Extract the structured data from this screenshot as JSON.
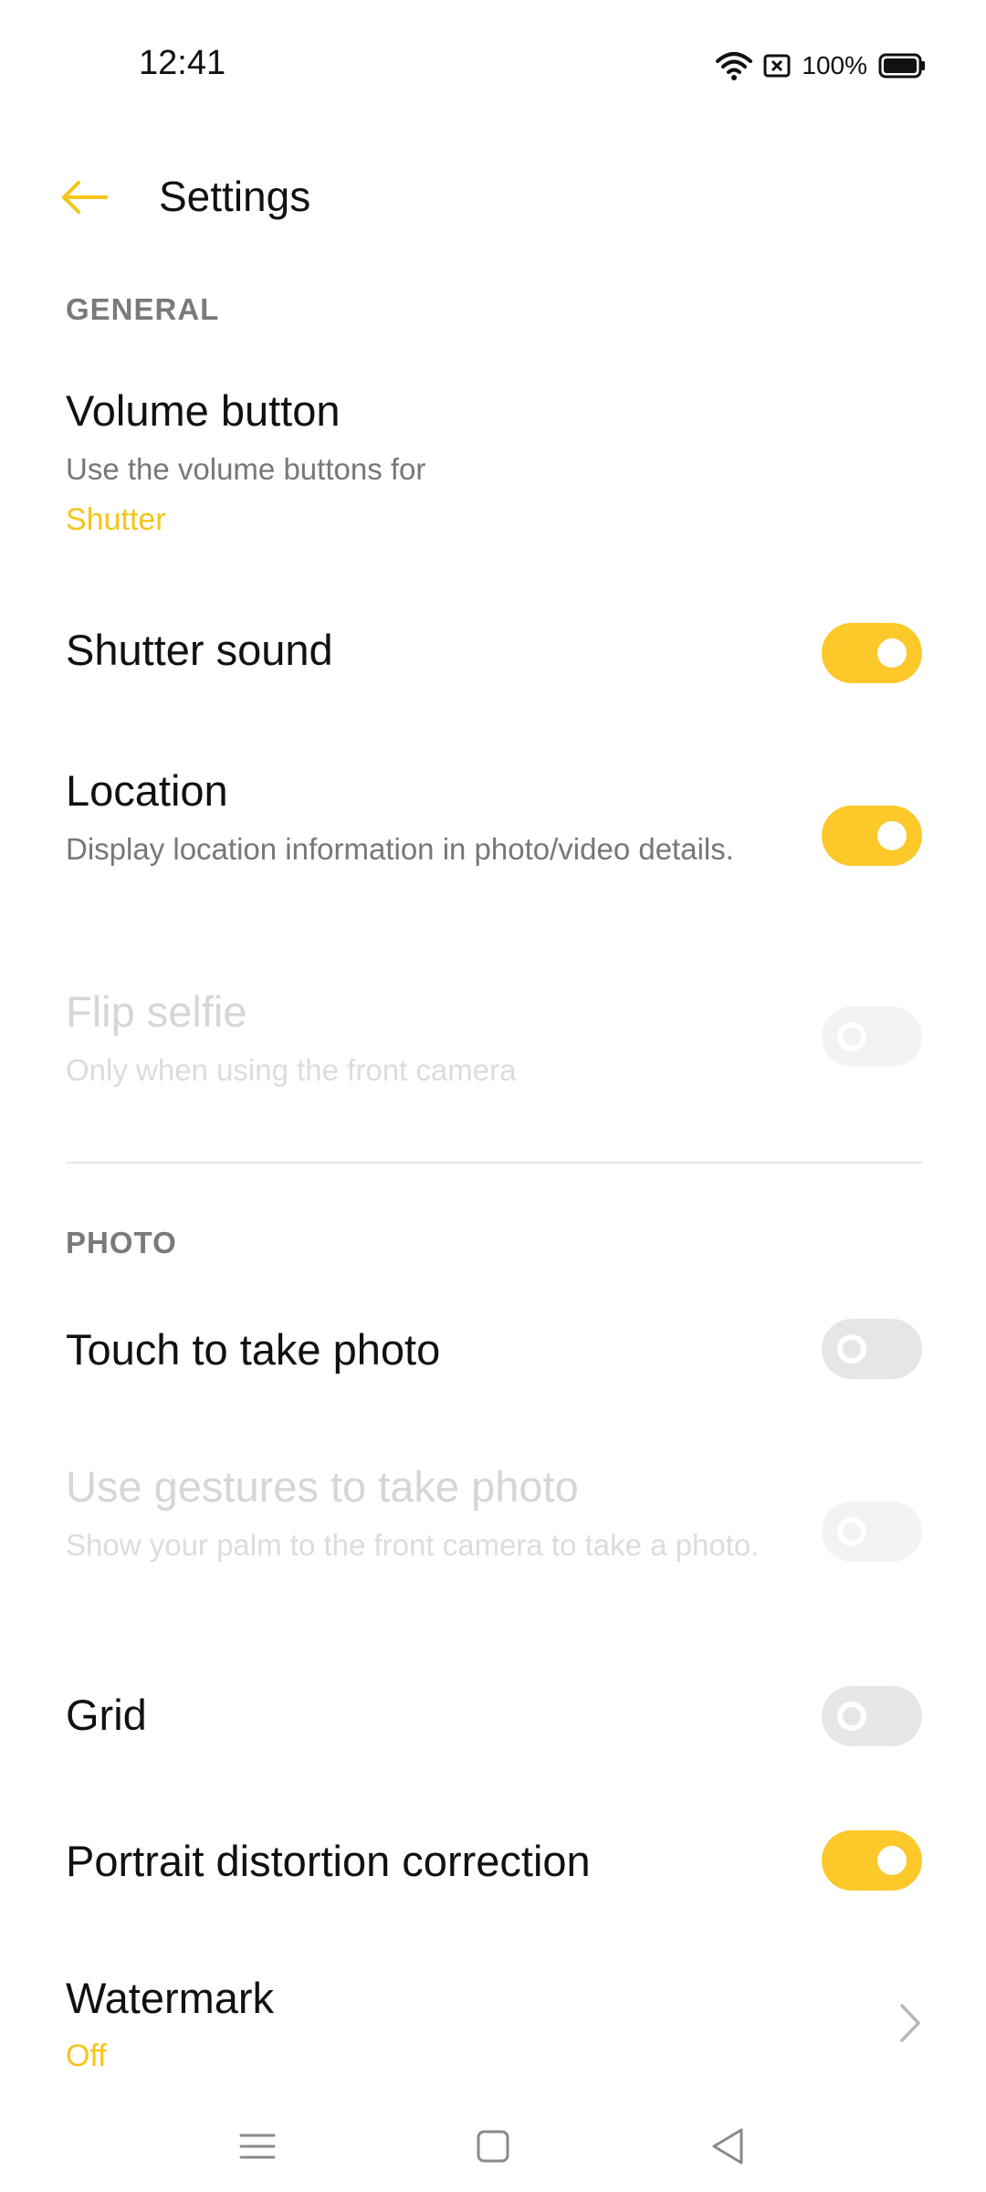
{
  "status": {
    "time": "12:41",
    "battery": "100%"
  },
  "header": {
    "title": "Settings"
  },
  "general": {
    "label": "GENERAL",
    "volume": {
      "title": "Volume button",
      "subtitle": "Use the volume buttons for",
      "value": "Shutter"
    },
    "shutter_sound": {
      "title": "Shutter sound",
      "state": "on"
    },
    "location": {
      "title": "Location",
      "subtitle": "Display location information in photo/video details.",
      "state": "on"
    },
    "flip_selfie": {
      "title": "Flip selfie",
      "subtitle": "Only when using the front camera",
      "state": "off-disabled"
    }
  },
  "photo": {
    "label": "PHOTO",
    "touch": {
      "title": "Touch to take photo",
      "state": "off"
    },
    "gestures": {
      "title": "Use gestures to take photo",
      "subtitle": "Show your palm to the front camera to take a photo.",
      "state": "off-disabled"
    },
    "grid": {
      "title": "Grid",
      "state": "off"
    },
    "portrait": {
      "title": "Portrait distortion correction",
      "state": "on"
    },
    "watermark": {
      "title": "Watermark",
      "value": "Off"
    }
  },
  "colors": {
    "accent": "#fcc82a",
    "accent_text": "#f5c518"
  }
}
